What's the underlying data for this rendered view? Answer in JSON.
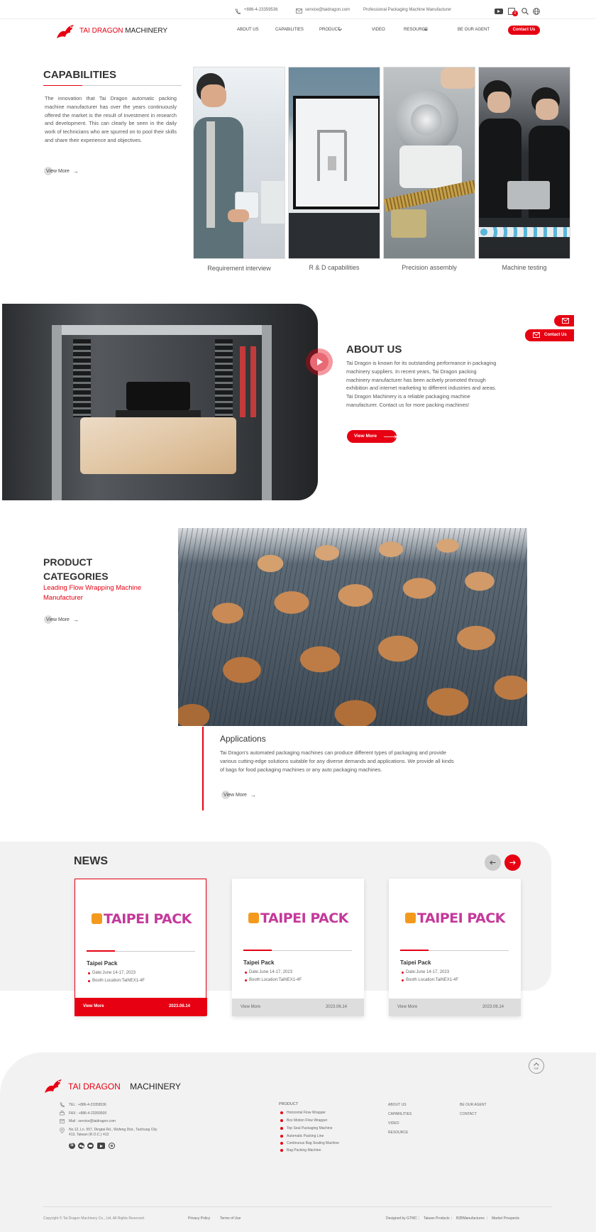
{
  "topbar": {
    "phone": "+886-4-23359536",
    "email": "service@taidragon.com",
    "tagline": "Professional Packaging Machine Manufacturer",
    "cart_count": "0"
  },
  "header": {
    "logo_red": "TAI DRAGON",
    "logo_black": "MACHINERY",
    "nav": [
      "ABOUT US",
      "CAPABILITIES",
      "PRODUCT",
      "VIDEO",
      "RESOURCE",
      "BE OUR AGENT"
    ],
    "contact_button": "Contact Us"
  },
  "capabilities": {
    "title": "CAPABILITIES",
    "text": "The innovation that Tai Dragon automatic packing machine manufacturer has over the years continuously offered the market is the result of investment in research and development. This can clearly be seen in the daily work of technicians who are spurred on to pool their skills and share their experience and objectives.",
    "view_more": "View More",
    "photos": [
      "Requirement interview",
      "R & D capabilities",
      "Precision assembly",
      "Machine testing"
    ]
  },
  "about": {
    "title": "ABOUT US",
    "text1": "Tai Dragon is known for its outstanding performance in packaging machinery suppliers. In recent years, Tai Dragon packing machinery manufacturer has been actively promoted through exhibition and internet marketing to different industries and areas.",
    "text2": "Tai Dragon Machinery is a reliable packaging machine manufacturer. Contact us for more packing machines!",
    "button": "View More"
  },
  "side": {
    "contact": "Contact Us"
  },
  "products": {
    "title_line1": "PRODUCT",
    "title_line2": "CATEGORIES",
    "subtitle": "Leading Flow Wrapping Machine Manufacturer",
    "view_more": "View More",
    "app_title": "Applications",
    "app_text": "Tai Dragon's automated packaging machines can produce different types of packaging and provide various cutting-edge solutions suitable for any diverse demands and applications. We provide all kinds of bags for food packaging machines or any auto packaging machines.",
    "app_view_more": "View More"
  },
  "news": {
    "title": "NEWS",
    "cards": [
      {
        "logo": "TAIPEI PACK",
        "title": "Taipei Pack",
        "date_line": "Date:June 14-17, 2023",
        "booth_line": "Booth Location:TaiNEX1-4F",
        "more": "View More",
        "date": "2023.06.14"
      },
      {
        "logo": "TAIPEI PACK",
        "title": "Taipei Pack",
        "date_line": "Date:June 14-17, 2023",
        "booth_line": "Booth Location:TaiNEX1-4F",
        "more": "View More",
        "date": "2023.06.14"
      },
      {
        "logo": "TAIPEI PACK",
        "title": "Taipei Pack",
        "date_line": "Date:June 14-17, 2023",
        "booth_line": "Booth Location:TaiNEX1-4F",
        "more": "View More",
        "date": "2023.06.14"
      }
    ]
  },
  "footer": {
    "top_label": "TOP",
    "logo_red": "TAI DRAGON",
    "logo_black": "MACHINERY",
    "tel": "TEL : +886-4-23359536",
    "fax": "FAX : +886-4-23359500",
    "mail": "Mail : service@taidragon.com",
    "address": "No.12, Ln. 557, Dingtai Rd., Wufeng Dist., Taichung City 413, Taiwan (R.O.C.) 413",
    "product_heading": "PRODUCT",
    "products": [
      "Horizontal Flow Wrapper",
      "Box Motion Flow Wrapper",
      "Top Seal Packaging Machine",
      "Automatic Packing Line",
      "Continuous Bag Sealing Machine",
      "Bag Packing Machine"
    ],
    "col3": [
      "ABOUT US",
      "CAPABILITIES",
      "VIDEO",
      "RESOURCE"
    ],
    "col4": [
      "BE OUR AGENT",
      "CONTACT"
    ],
    "copyright": "Copyright © Tai Dragon Machinery Co., Ltd. All Rights Reserved.",
    "privacy": "Privacy Policy",
    "terms": "Terms of Use",
    "credits": [
      "Designed by GTMC",
      "Taiwan Products",
      "B2BManufactures",
      "Market Prospects"
    ]
  }
}
